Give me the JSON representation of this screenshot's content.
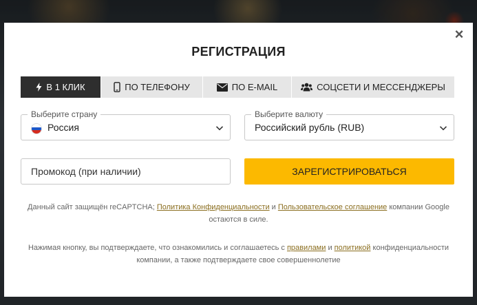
{
  "modal": {
    "title": "РЕГИСТРАЦИЯ",
    "close_label": "×"
  },
  "tabs": [
    {
      "label": "В 1 КЛИК",
      "icon": "lightning-icon",
      "active": true
    },
    {
      "label": "ПО ТЕЛЕФОНУ",
      "icon": "phone-icon",
      "active": false
    },
    {
      "label": "ПО E-MAIL",
      "icon": "envelope-icon",
      "active": false
    },
    {
      "label": "СОЦСЕТИ И МЕССЕНДЖЕРЫ",
      "icon": "users-icon",
      "active": false
    }
  ],
  "country": {
    "legend": "Выберите страну",
    "value": "Россия",
    "flag_colors": [
      "#ffffff",
      "#1c57c9",
      "#d52b1e"
    ]
  },
  "currency": {
    "legend": "Выберите валюту",
    "value": "Российский рубль (RUB)"
  },
  "promo": {
    "placeholder": "Промокод (при наличии)"
  },
  "register_button": {
    "label": "ЗАРЕГИСТРИРОВАТЬСЯ",
    "color": "#fcb900"
  },
  "recaptcha_note": {
    "prefix": "Данный сайт защищён reCAPTCHA; ",
    "privacy_link": "Политика Конфиденциальности",
    "and": " и ",
    "terms_link": "Пользовательское соглашение",
    "suffix": " компании Google остаются в силе."
  },
  "consent_note": {
    "prefix": "Нажимая кнопку, вы подтверждаете, что ознакомились и соглашаетесь с ",
    "rules_link": "правилами",
    "and": " и ",
    "policy_link": "политикой",
    "suffix": " конфиденциальности компании, а также подтверждаете свое совершеннолетие"
  },
  "colors": {
    "accent": "#fcb900",
    "active_tab": "#2e2e2e",
    "link": "#8a6d1e"
  }
}
